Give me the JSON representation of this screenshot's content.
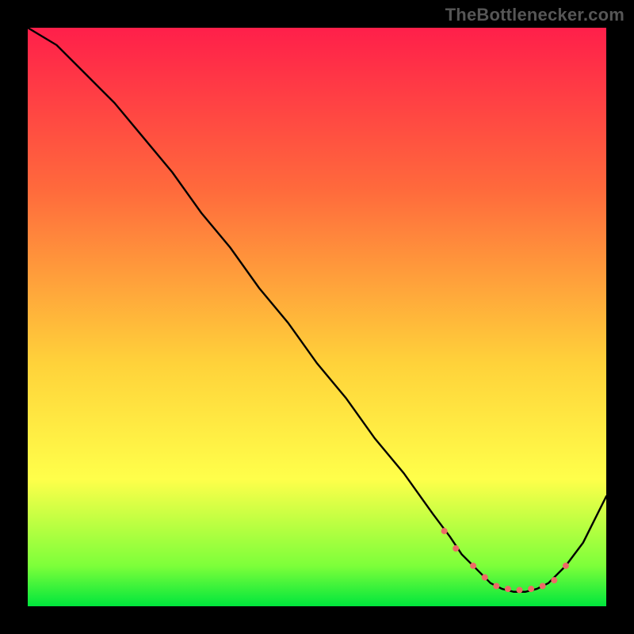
{
  "attribution": "TheBottlenecker.com",
  "chart_data": {
    "type": "line",
    "title": "",
    "xlabel": "",
    "ylabel": "",
    "xlim": [
      0,
      100
    ],
    "ylim": [
      0,
      100
    ],
    "gradient_colors": [
      "#ff1f4a",
      "#ff6a3c",
      "#ffd23a",
      "#ffff4a",
      "#7dff3a",
      "#00e63c"
    ],
    "curve_style": {
      "stroke": "#000000",
      "width": 2.4
    },
    "marker_style": {
      "fill": "#ed6a66",
      "radius": 4,
      "stroke": "none"
    },
    "series": [
      {
        "name": "bottleneck-curve",
        "x": [
          0,
          5,
          10,
          15,
          20,
          25,
          30,
          35,
          40,
          45,
          50,
          55,
          60,
          65,
          70,
          73,
          75,
          78,
          80,
          82,
          84,
          86,
          88,
          90,
          93,
          96,
          100
        ],
        "y": [
          100,
          97,
          92,
          87,
          81,
          75,
          68,
          62,
          55,
          49,
          42,
          36,
          29,
          23,
          16,
          12,
          9,
          6,
          4,
          3,
          2.5,
          2.5,
          3,
          4,
          7,
          11,
          19
        ]
      }
    ],
    "markers": {
      "name": "highlight-points",
      "x": [
        72,
        74,
        77,
        79,
        81,
        83,
        85,
        87,
        89,
        91,
        93
      ],
      "y": [
        13,
        10,
        7,
        5,
        3.5,
        3,
        2.8,
        3,
        3.5,
        4.5,
        7
      ]
    }
  }
}
